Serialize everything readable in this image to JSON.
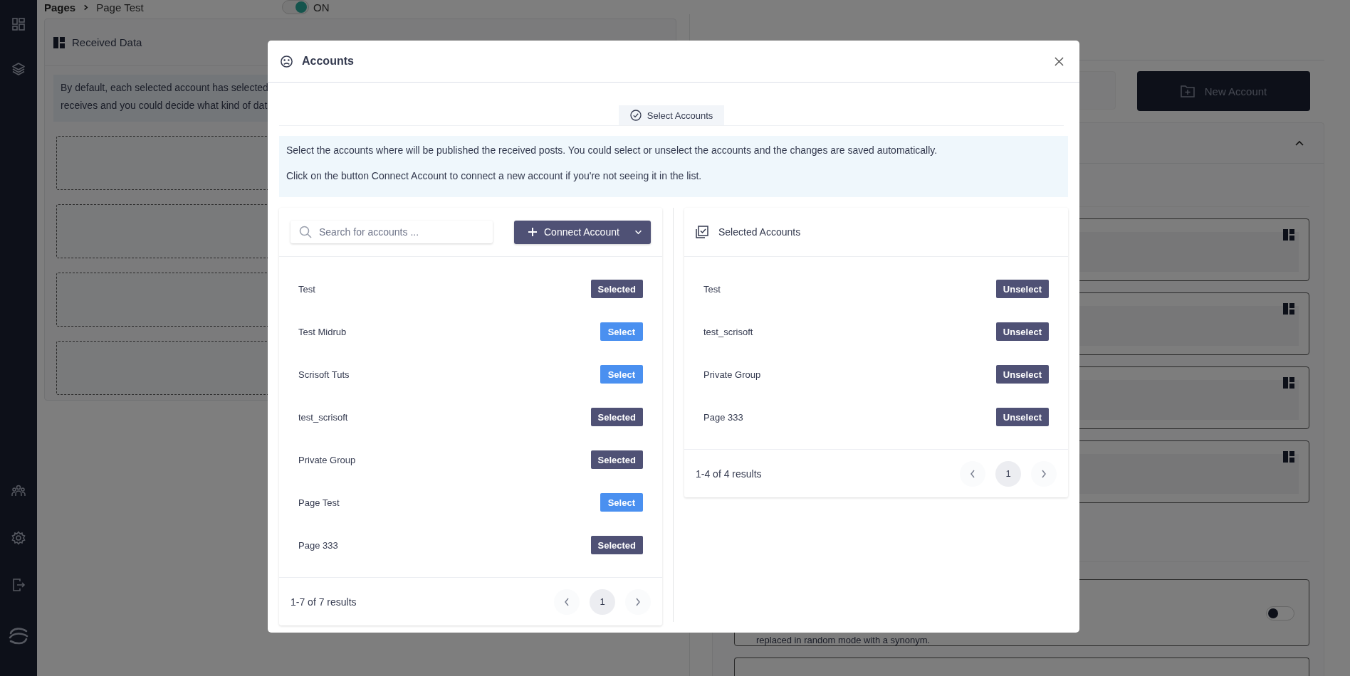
{
  "breadcrumb": {
    "items": [
      "Pages",
      "Page Test"
    ]
  },
  "status_switch": {
    "label": "ON",
    "on": true
  },
  "received_data": {
    "title": "Received Data",
    "notice": [
      "By default, each selected account has selected",
      "receives and you could decide what kind of dat"
    ]
  },
  "new_account_button": {
    "label": "New Account"
  },
  "option_card": {
    "text": "replaced in random mode with a synonym.",
    "on": false
  },
  "modal": {
    "title": "Accounts",
    "tabs": [
      {
        "label": "Select Accounts",
        "selected": true
      }
    ],
    "info": [
      "Select the accounts where will be published the received posts. You could select or unselect the accounts and the changes are saved automatically.",
      "Click on the button Connect Account to connect a new account if you're not seeing it in the list."
    ],
    "search": {
      "placeholder": "Search for accounts ..."
    },
    "connect_button": {
      "label": "Connect Account"
    },
    "accounts": [
      {
        "name": "Test",
        "action": "Selected",
        "selected": true
      },
      {
        "name": "Test Midrub",
        "action": "Select",
        "selected": false
      },
      {
        "name": "Scrisoft Tuts",
        "action": "Select",
        "selected": false
      },
      {
        "name": "test_scrisoft",
        "action": "Selected",
        "selected": true
      },
      {
        "name": "Private Group",
        "action": "Selected",
        "selected": true
      },
      {
        "name": "Page Test",
        "action": "Select",
        "selected": false
      },
      {
        "name": "Page 333",
        "action": "Selected",
        "selected": true
      }
    ],
    "accounts_footer": {
      "summary": "1-7 of 7 results",
      "pages": [
        {
          "label": "1",
          "selected": true
        }
      ]
    },
    "selected_panel": {
      "title": "Selected Accounts",
      "items": [
        {
          "name": "Test",
          "action": "Unselect"
        },
        {
          "name": "test_scrisoft",
          "action": "Unselect"
        },
        {
          "name": "Private Group",
          "action": "Unselect"
        },
        {
          "name": "Page 333",
          "action": "Unselect"
        }
      ],
      "summary": "1-4 of 4 results",
      "pages": [
        {
          "label": "1",
          "selected": true
        }
      ]
    }
  }
}
